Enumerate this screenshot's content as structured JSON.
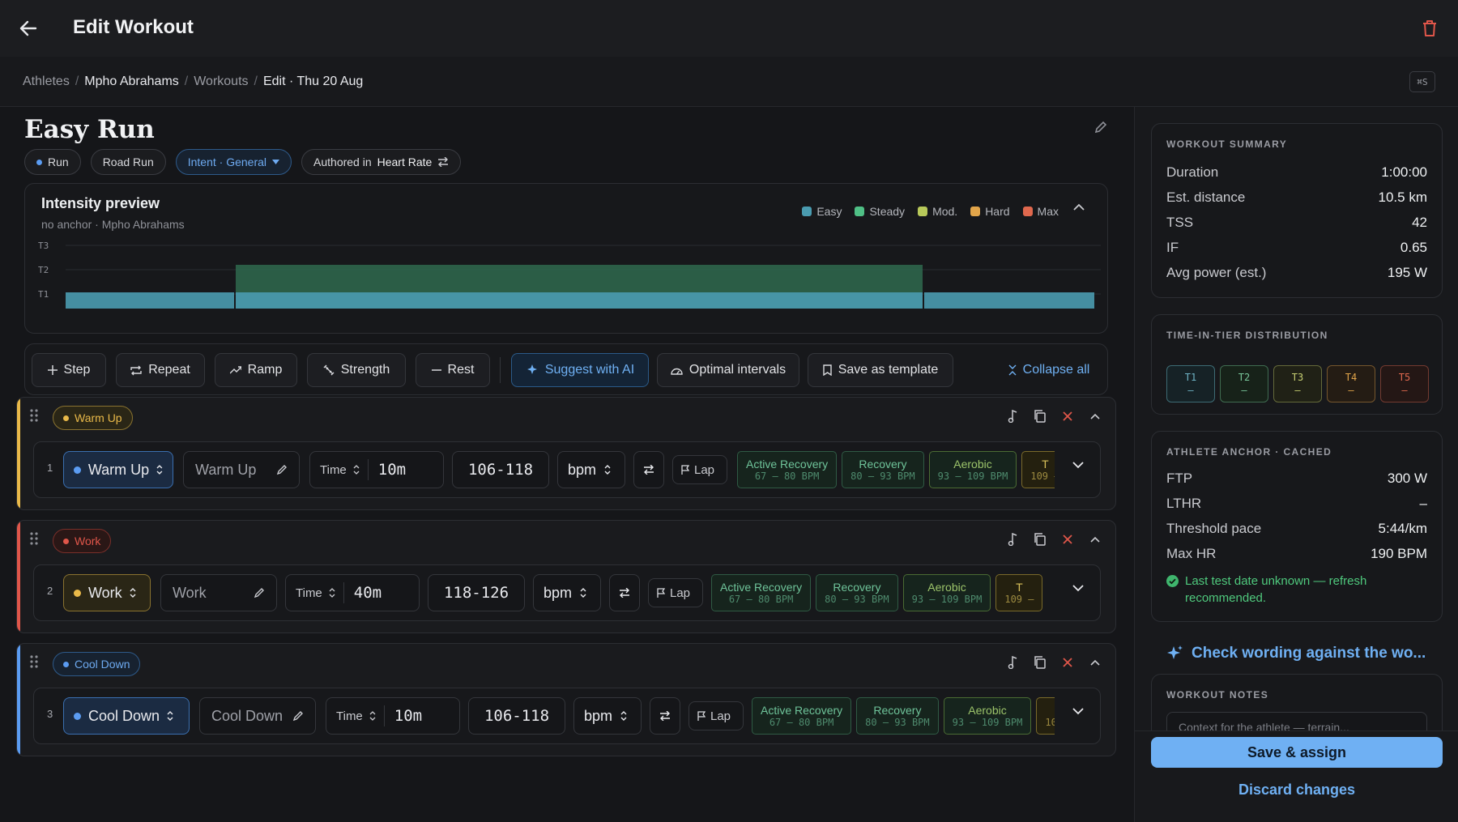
{
  "header": {
    "title": "Edit Workout"
  },
  "breadcrumb": {
    "items": [
      "Athletes",
      "Mpho Abrahams",
      "Workouts",
      "Edit · Thu 20 Aug"
    ],
    "shortcut": "⌘S"
  },
  "workout": {
    "title": "Easy Run",
    "chips": {
      "sport": "Run",
      "subtype": "Road Run",
      "intent": "Intent · General",
      "authored_prefix": "Authored in",
      "authored_value": "Heart Rate"
    }
  },
  "preview": {
    "title": "Intensity preview",
    "subtitle": "no anchor · Mpho Abrahams",
    "legend": [
      {
        "label": "Easy",
        "color": "#4a9bb0"
      },
      {
        "label": "Steady",
        "color": "#4fbf85"
      },
      {
        "label": "Mod.",
        "color": "#b8c95a"
      },
      {
        "label": "Hard",
        "color": "#e2a54a"
      },
      {
        "label": "Max",
        "color": "#e0684e"
      }
    ],
    "tiers": [
      "T3",
      "T2",
      "T1"
    ]
  },
  "toolbar": {
    "step": "Step",
    "repeat": "Repeat",
    "ramp": "Ramp",
    "strength": "Strength",
    "rest": "Rest",
    "suggest": "Suggest with AI",
    "optimal": "Optimal intervals",
    "save_template": "Save as template",
    "collapse": "Collapse all"
  },
  "blocks": [
    {
      "tag": "Warm Up",
      "color": "#e9b949",
      "step": {
        "num": "1",
        "type": "Warm Up",
        "name": "Warm Up",
        "mode": "Time",
        "duration": "10m",
        "range": "106-118",
        "unit": "bpm",
        "lap": "Lap"
      }
    },
    {
      "tag": "Work",
      "color": "#e0564a",
      "step": {
        "num": "2",
        "type": "Work",
        "name": "Work",
        "mode": "Time",
        "duration": "40m",
        "range": "118-126",
        "unit": "bpm",
        "lap": "Lap"
      }
    },
    {
      "tag": "Cool Down",
      "color": "#5b9cf2",
      "step": {
        "num": "3",
        "type": "Cool Down",
        "name": "Cool Down",
        "mode": "Time",
        "duration": "10m",
        "range": "106-118",
        "unit": "bpm",
        "lap": "Lap"
      }
    }
  ],
  "zones": [
    {
      "name": "Active Recovery",
      "range": "67 – 80 BPM"
    },
    {
      "name": "Recovery",
      "range": "80 – 93 BPM"
    },
    {
      "name": "Aerobic",
      "range": "93 – 109 BPM"
    },
    {
      "name": "T",
      "range": "109 –"
    }
  ],
  "summary": {
    "label": "WORKOUT SUMMARY",
    "rows": [
      {
        "k": "Duration",
        "v": "1:00:00"
      },
      {
        "k": "Est. distance",
        "v": "10.5 km"
      },
      {
        "k": "TSS",
        "v": "42"
      },
      {
        "k": "IF",
        "v": "0.65"
      },
      {
        "k": "Avg power (est.)",
        "v": "195 W"
      }
    ]
  },
  "tiers": {
    "label": "TIME-IN-TIER DISTRIBUTION",
    "items": [
      {
        "name": "T1",
        "value": "–",
        "color": "#6fb4c6"
      },
      {
        "name": "T2",
        "value": "–",
        "color": "#79c69a"
      },
      {
        "name": "T3",
        "value": "–",
        "color": "#c6cf72"
      },
      {
        "name": "T4",
        "value": "–",
        "color": "#e2a54a"
      },
      {
        "name": "T5",
        "value": "–",
        "color": "#e0684e"
      }
    ]
  },
  "anchor": {
    "label": "ATHLETE ANCHOR · CACHED",
    "rows": [
      {
        "k": "FTP",
        "v": "300 W"
      },
      {
        "k": "LTHR",
        "v": "–"
      },
      {
        "k": "Threshold pace",
        "v": "5:44/km"
      },
      {
        "k": "Max HR",
        "v": "190 BPM"
      }
    ],
    "note": "Last test date unknown — refresh recommended."
  },
  "check": {
    "label": "Check wording against the wo..."
  },
  "notes": {
    "label": "WORKOUT NOTES",
    "placeholder": "Context for the athlete — terrain..."
  },
  "actions": {
    "save": "Save & assign",
    "discard": "Discard changes"
  }
}
